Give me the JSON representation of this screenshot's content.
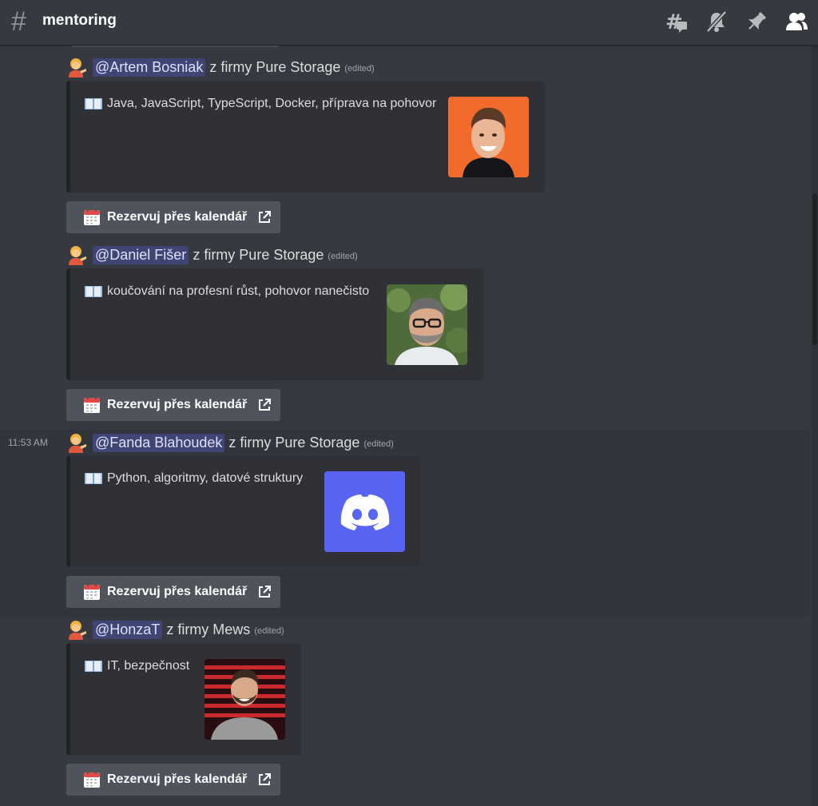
{
  "header": {
    "channel_name": "mentoring",
    "icons": [
      "threads-icon",
      "notification-muted-icon",
      "pin-icon",
      "member-list-icon"
    ]
  },
  "button_label": "Rezervuj přes kalendář",
  "messages": [
    {
      "timestamp": "",
      "mention": "@Artem Bosniak",
      "company": "z firmy Pure Storage",
      "edited": "(edited)",
      "description": "Java, JavaScript, TypeScript, Docker, příprava na pohovor",
      "thumbnail": "photo-orange-background"
    },
    {
      "timestamp": "",
      "mention": "@Daniel Fišer",
      "company": "z firmy Pure Storage",
      "edited": "(edited)",
      "description": "koučování na profesní růst, pohovor nanečisto",
      "thumbnail": "photo-green-background"
    },
    {
      "timestamp": "11:53 AM",
      "mention": "@Fanda Blahoudek",
      "company": "z firmy Pure Storage",
      "edited": "(edited)",
      "description": "Python, algoritmy, datové struktury",
      "thumbnail": "discord-logo"
    },
    {
      "timestamp": "",
      "mention": "@HonzaT",
      "company": "z firmy Mews",
      "edited": "(edited)",
      "description": "IT, bezpečnost",
      "thumbnail": "photo-red-stripes-background"
    }
  ],
  "colors": {
    "background": "#36393f",
    "embed": "#2f3136",
    "mention_bg": "#3f4574",
    "button": "#4f545c",
    "discord_blurple": "#5865f2"
  }
}
